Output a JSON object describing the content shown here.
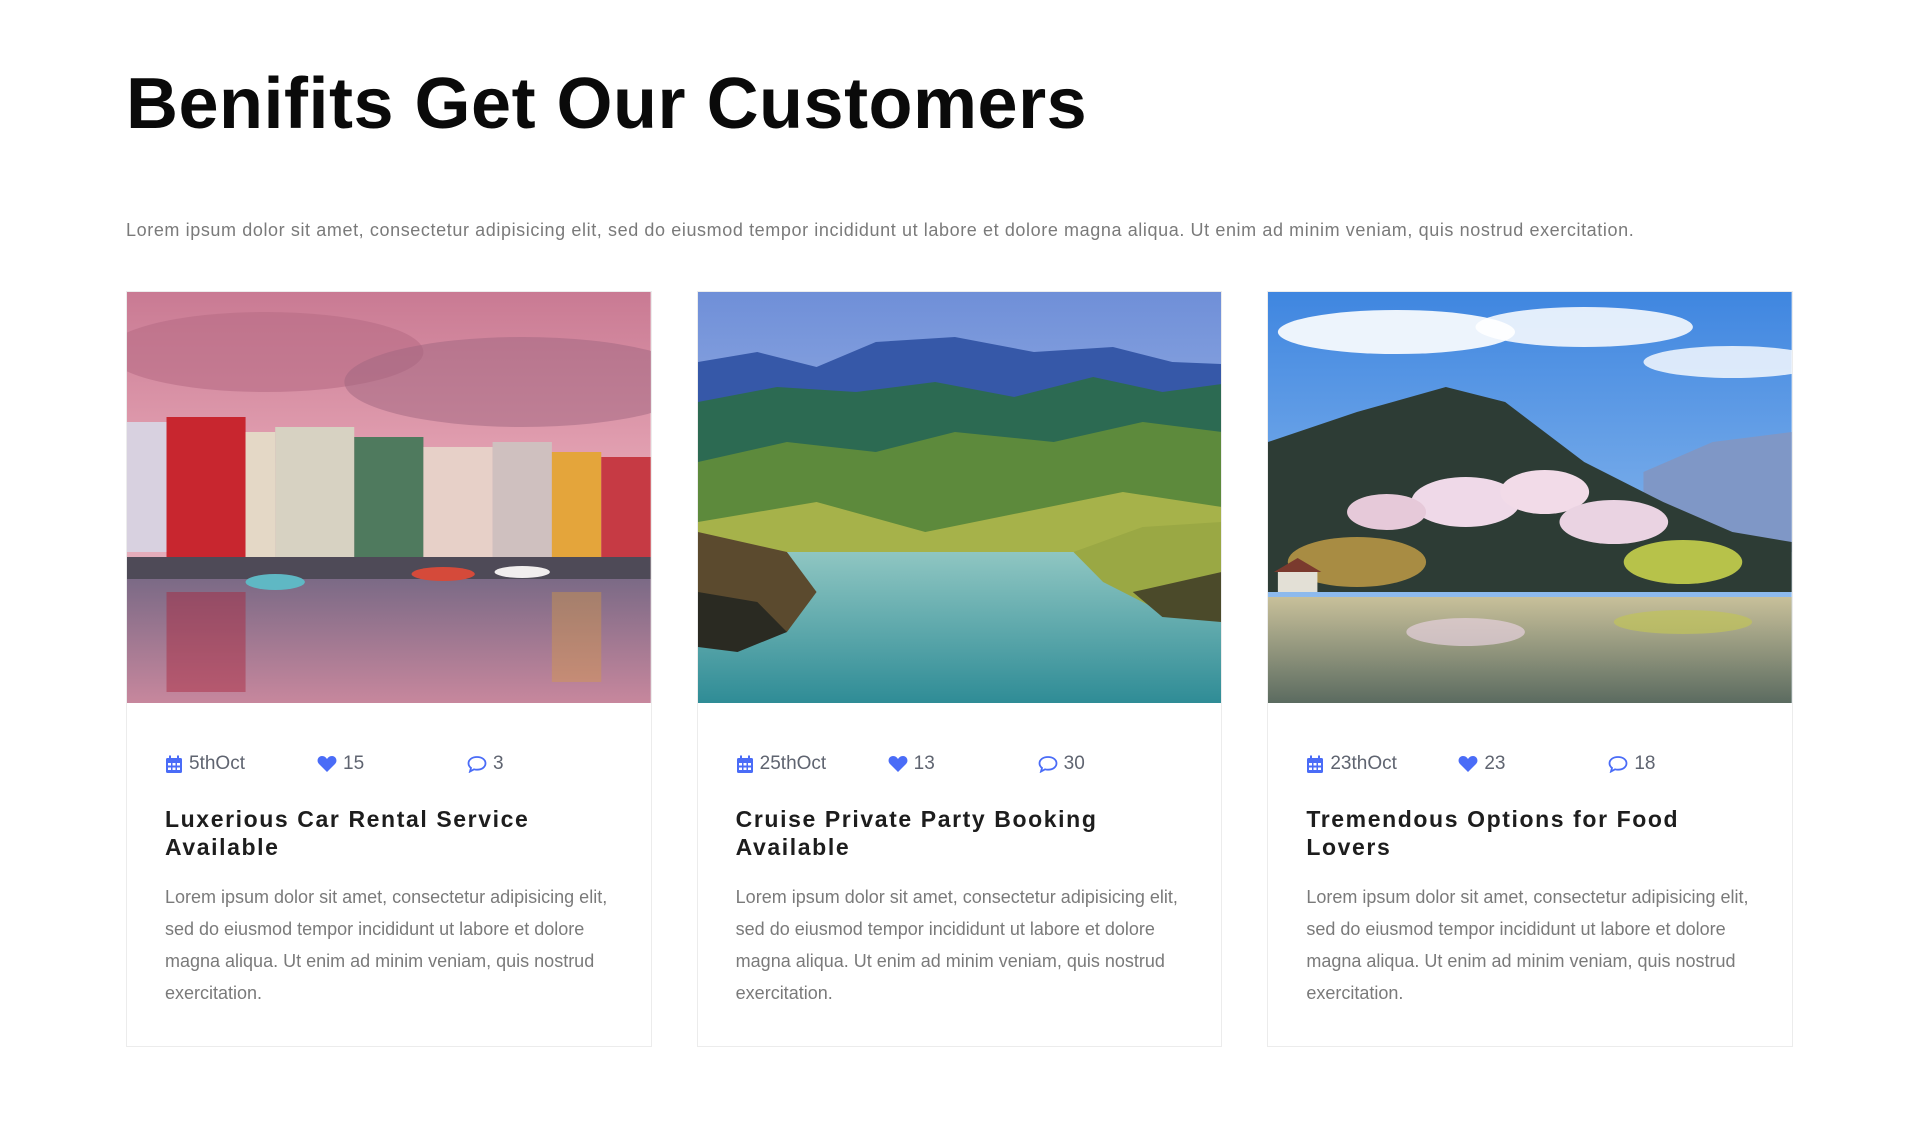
{
  "section": {
    "title": "Benifits Get Our Customers",
    "intro": "Lorem ipsum dolor sit amet, consectetur adipisicing elit, sed do eiusmod tempor incididunt ut labore et dolore magna aliqua. Ut enim ad minim veniam, quis nostrud exercitation."
  },
  "colors": {
    "accent": "#4a6cf7",
    "title": "#0a0a0a",
    "muted": "#7a7a7a"
  },
  "cards": [
    {
      "image": "photo-harbor-colorful-houses-pink-sky",
      "date": "5thOct",
      "likes": "15",
      "comments": "3",
      "title": "Luxerious Car Rental Service Available",
      "text": "Lorem ipsum dolor sit amet, consectetur adipisicing elit, sed do eiusmod tempor incididunt ut labore et dolore magna aliqua. Ut enim ad minim veniam, quis nostrud exercitation."
    },
    {
      "image": "photo-mountain-lake-valley",
      "date": "25thOct",
      "likes": "13",
      "comments": "30",
      "title": "Cruise Private Party Booking Available",
      "text": "Lorem ipsum dolor sit amet, consectetur adipisicing elit, sed do eiusmod tempor incididunt ut labore et dolore magna aliqua. Ut enim ad minim veniam, quis nostrud exercitation."
    },
    {
      "image": "photo-cherry-blossom-mountain-lake",
      "date": "23thOct",
      "likes": "23",
      "comments": "18",
      "title": "Tremendous Options for Food Lovers",
      "text": "Lorem ipsum dolor sit amet, consectetur adipisicing elit, sed do eiusmod tempor incididunt ut labore et dolore magna aliqua. Ut enim ad minim veniam, quis nostrud exercitation."
    }
  ],
  "icons": {
    "date": "calendar-icon",
    "likes": "heart-icon",
    "comments": "comment-icon"
  }
}
